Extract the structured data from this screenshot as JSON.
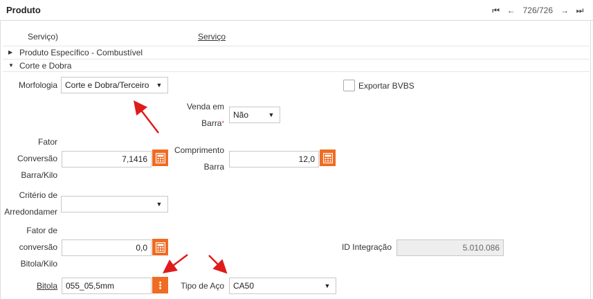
{
  "header": {
    "title": "Produto",
    "counter": "726/726"
  },
  "top_partial": {
    "left_text": "Serviço)",
    "right_link": "Serviço"
  },
  "sections": {
    "combustivel": "Produto Específico - Combustível",
    "corte_dobra": "Corte e Dobra"
  },
  "form": {
    "morfologia": {
      "label": "Morfologia",
      "value": "Corte e Dobra/Terceiro"
    },
    "exportar_bvbs": {
      "label": "Exportar BVBS",
      "checked": false
    },
    "venda_em_barra": {
      "label_line1": "Venda em",
      "label_line2": "Barra",
      "required_mark": "*",
      "value": "Não"
    },
    "fator_conversao_barra": {
      "label_line1": "Fator",
      "label_line2": "Conversão",
      "label_line3": "Barra/Kilo",
      "value": "7,1416"
    },
    "comprimento_barra": {
      "label_line1": "Comprimento",
      "label_line2": "Barra",
      "value": "12,0"
    },
    "criterio_arredondamento": {
      "label_line1": "Critério de",
      "label_line2": "Arredondamer",
      "value": ""
    },
    "fator_conversao_bitola": {
      "label_line1": "Fator de",
      "label_line2": "conversão",
      "label_line3": "Bitola/Kilo",
      "value": "0,0"
    },
    "id_integracao": {
      "label": "ID Integração",
      "value": "5.010.086"
    },
    "bitola": {
      "label": "Bitola",
      "value": "055_05,5mm"
    },
    "tipo_aco": {
      "label": "Tipo de Aço",
      "value": "CA50"
    }
  },
  "colors": {
    "accent": "#ef6c23",
    "annotation_arrow": "#e01b1b"
  }
}
